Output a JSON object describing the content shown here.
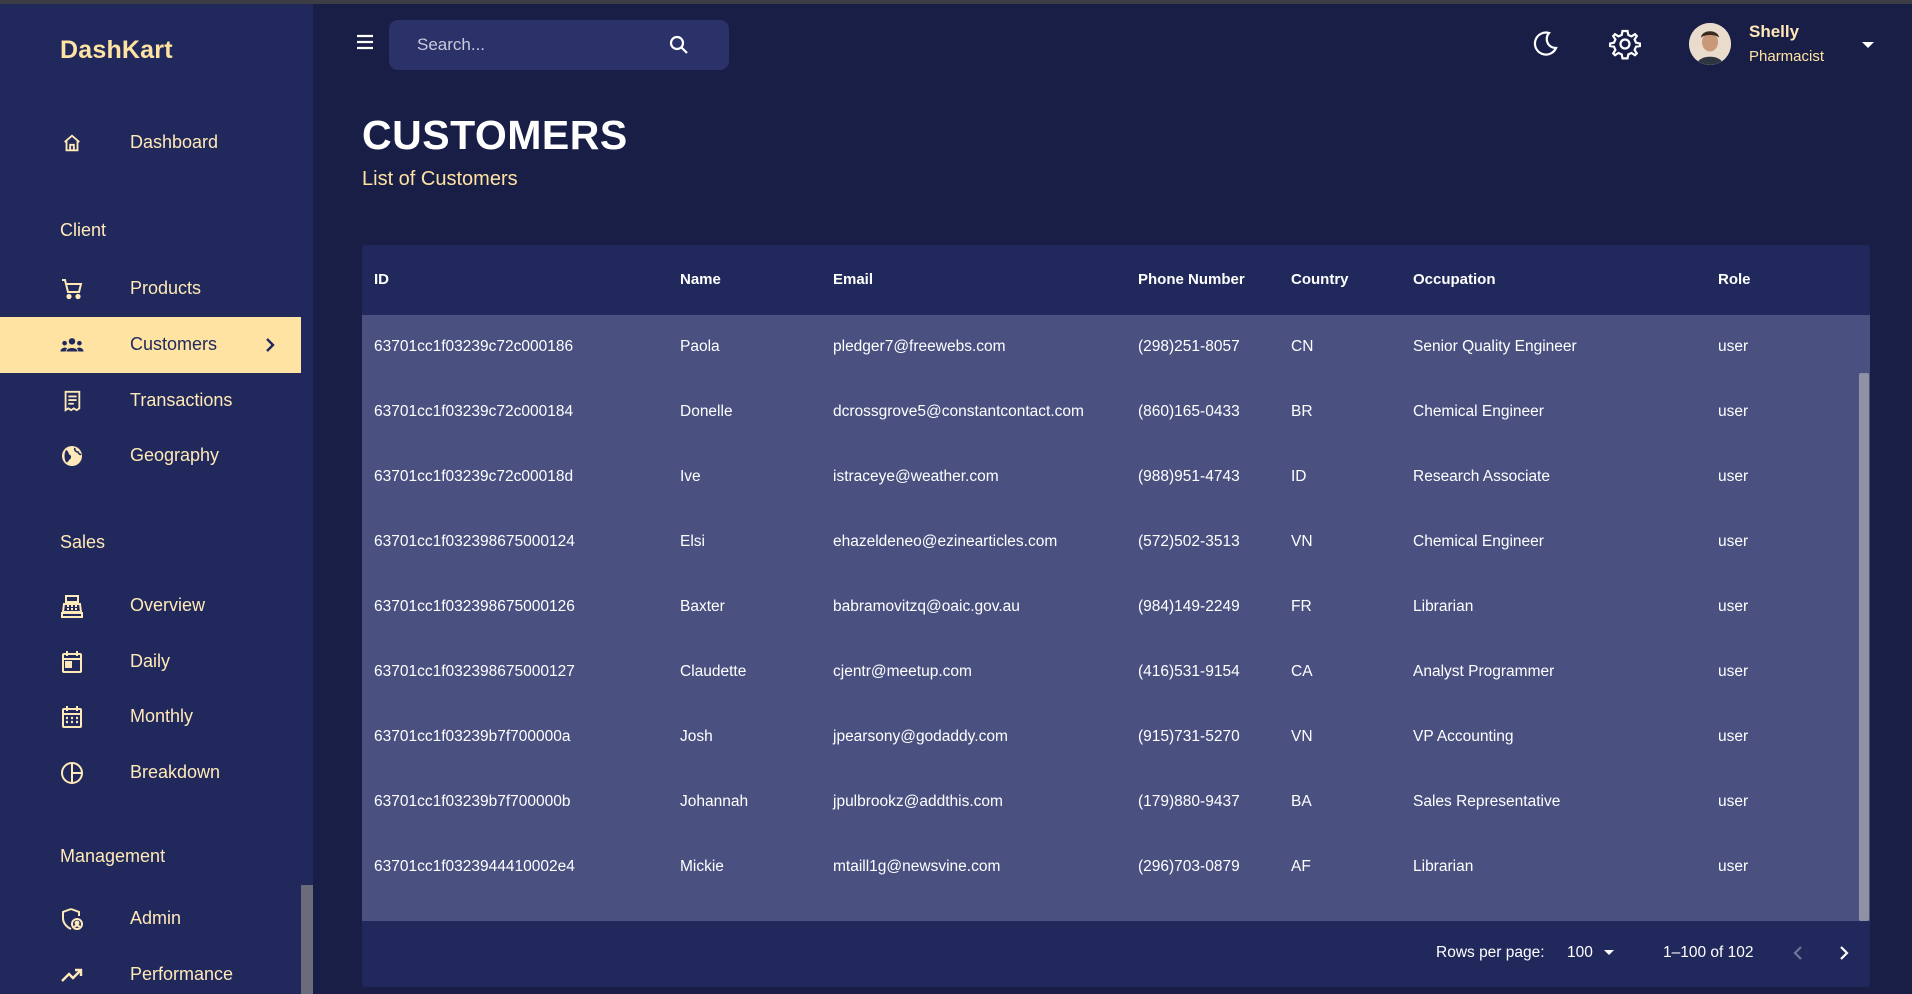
{
  "app": {
    "brand": "DashKart"
  },
  "sidebar": {
    "items": [
      {
        "label": "Dashboard",
        "icon": "home-icon"
      },
      {
        "label": "Products",
        "icon": "shopping-cart-icon"
      },
      {
        "label": "Customers",
        "icon": "groups-icon",
        "active": true
      },
      {
        "label": "Transactions",
        "icon": "receipt-icon"
      },
      {
        "label": "Geography",
        "icon": "globe-icon"
      },
      {
        "label": "Overview",
        "icon": "point-of-sale-icon"
      },
      {
        "label": "Daily",
        "icon": "calendar-today-icon"
      },
      {
        "label": "Monthly",
        "icon": "calendar-month-icon"
      },
      {
        "label": "Breakdown",
        "icon": "pie-chart-icon"
      },
      {
        "label": "Admin",
        "icon": "admin-icon"
      },
      {
        "label": "Performance",
        "icon": "trending-up-icon"
      }
    ],
    "sections": {
      "client": "Client",
      "sales": "Sales",
      "management": "Management"
    }
  },
  "topbar": {
    "search_placeholder": "Search...",
    "user_name": "Shelly",
    "user_role": "Pharmacist"
  },
  "page": {
    "title": "CUSTOMERS",
    "subtitle": "List of Customers"
  },
  "table": {
    "columns": [
      "ID",
      "Name",
      "Email",
      "Phone Number",
      "Country",
      "Occupation",
      "Role"
    ],
    "rows": [
      [
        "63701cc1f03239c72c000186",
        "Paola",
        "pledger7@freewebs.com",
        "(298)251-8057",
        "CN",
        "Senior Quality Engineer",
        "user"
      ],
      [
        "63701cc1f03239c72c000184",
        "Donelle",
        "dcrossgrove5@constantcontact.com",
        "(860)165-0433",
        "BR",
        "Chemical Engineer",
        "user"
      ],
      [
        "63701cc1f03239c72c00018d",
        "Ive",
        "istraceye@weather.com",
        "(988)951-4743",
        "ID",
        "Research Associate",
        "user"
      ],
      [
        "63701cc1f032398675000124",
        "Elsi",
        "ehazeldeneo@ezinearticles.com",
        "(572)502-3513",
        "VN",
        "Chemical Engineer",
        "user"
      ],
      [
        "63701cc1f032398675000126",
        "Baxter",
        "babramovitzq@oaic.gov.au",
        "(984)149-2249",
        "FR",
        "Librarian",
        "user"
      ],
      [
        "63701cc1f032398675000127",
        "Claudette",
        "cjentr@meetup.com",
        "(416)531-9154",
        "CA",
        "Analyst Programmer",
        "user"
      ],
      [
        "63701cc1f03239b7f700000a",
        "Josh",
        "jpearsony@godaddy.com",
        "(915)731-5270",
        "VN",
        "VP Accounting",
        "user"
      ],
      [
        "63701cc1f03239b7f700000b",
        "Johannah",
        "jpulbrookz@addthis.com",
        "(179)880-9437",
        "BA",
        "Sales Representative",
        "user"
      ],
      [
        "63701cc1f0323944410002e4",
        "Mickie",
        "mtaill1g@newsvine.com",
        "(296)703-0879",
        "AF",
        "Librarian",
        "user"
      ]
    ]
  },
  "footer": {
    "rows_per_page_label": "Rows per page:",
    "rows_per_page_value": "100",
    "range_text": "1–100 of 102"
  },
  "colors": {
    "background": "#191e46",
    "sidebar": "#21295c",
    "accent": "#ffe3a3",
    "table_body": "#4a5181"
  }
}
